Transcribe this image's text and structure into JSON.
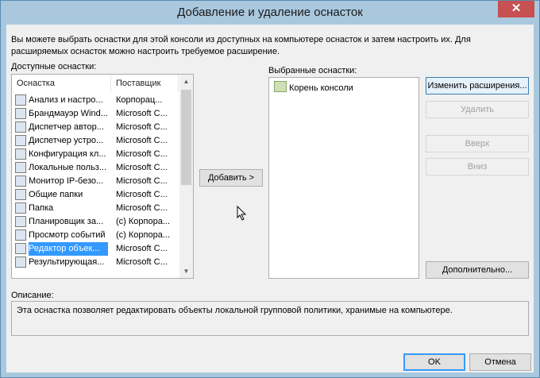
{
  "window": {
    "title": "Добавление и удаление оснасток",
    "close_glyph": "✕"
  },
  "intro": "Вы можете выбрать оснастки для этой консоли из доступных на компьютере оснасток и затем настроить их. Для расширяемых оснасток можно настроить требуемое расширение.",
  "available": {
    "label": "Доступные оснастки:",
    "col_snapin": "Оснастка",
    "col_vendor": "Поставщик",
    "items": [
      {
        "name": "Анализ и настро...",
        "vendor": "Корпорац...",
        "icon": "security-analysis-icon"
      },
      {
        "name": "Брандмауэр Wind...",
        "vendor": "Microsoft C...",
        "icon": "firewall-icon"
      },
      {
        "name": "Диспетчер автор...",
        "vendor": "Microsoft C...",
        "icon": "authorization-manager-icon"
      },
      {
        "name": "Диспетчер устро...",
        "vendor": "Microsoft C...",
        "icon": "device-manager-icon"
      },
      {
        "name": "Конфигурация кл...",
        "vendor": "Microsoft C...",
        "icon": "client-config-icon"
      },
      {
        "name": "Локальные польз...",
        "vendor": "Microsoft C...",
        "icon": "local-users-icon"
      },
      {
        "name": "Монитор IP-безо...",
        "vendor": "Microsoft C...",
        "icon": "ipsec-monitor-icon"
      },
      {
        "name": "Общие папки",
        "vendor": "Microsoft C...",
        "icon": "shared-folders-icon"
      },
      {
        "name": "Папка",
        "vendor": "Microsoft C...",
        "icon": "folder-icon"
      },
      {
        "name": "Планировщик за...",
        "vendor": "(с) Корпора...",
        "icon": "task-scheduler-icon"
      },
      {
        "name": "Просмотр событий",
        "vendor": "(с) Корпора...",
        "icon": "event-viewer-icon"
      },
      {
        "name": "Редактор объек...",
        "vendor": "Microsoft C...",
        "icon": "gpo-editor-icon"
      },
      {
        "name": "Результирующая...",
        "vendor": "Microsoft C...",
        "icon": "rsop-icon"
      }
    ]
  },
  "add_button": "Добавить >",
  "selected": {
    "label": "Выбранные оснастки:",
    "root": "Корень консоли"
  },
  "buttons": {
    "edit_extensions": "Изменить расширения...",
    "remove": "Удалить",
    "up": "Вверх",
    "down": "Вниз",
    "advanced": "Дополнительно...",
    "ok": "OK",
    "cancel": "Отмена"
  },
  "description": {
    "label": "Описание:",
    "text": "Эта оснастка позволяет редактировать объекты локальной групповой политики, хранимые на компьютере."
  }
}
